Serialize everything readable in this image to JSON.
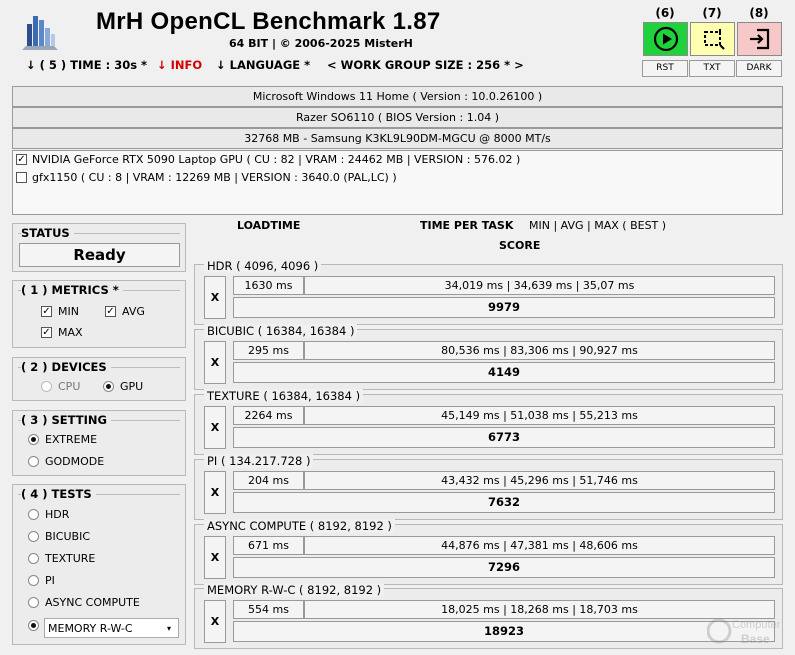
{
  "header": {
    "title": "MrH OpenCL Benchmark 1.87",
    "subtitle": "64 BIT | ©  2006-2025 MisterH",
    "logo_icon": "building-bars-logo"
  },
  "menu": {
    "time": "↓ ( 5 ) TIME : 30s *",
    "info": "↓ INFO",
    "language": "↓ LANGUAGE *",
    "work_group": "< WORK GROUP SIZE : 256 * >"
  },
  "toolbar": {
    "run": {
      "num": "(6)",
      "label": "RST",
      "icon": "play-circle-icon",
      "bg": "#1fd13a"
    },
    "txt": {
      "num": "(7)",
      "label": "TXT",
      "icon": "crop-select-icon",
      "bg": "#ffffb0"
    },
    "dark": {
      "num": "(8)",
      "label": "DARK",
      "icon": "exit-door-icon",
      "bg": "#f7c8c8"
    }
  },
  "system": {
    "os": "Microsoft Windows 11 Home ( Version : 10.0.26100 )",
    "board": "Razer SO6110 ( BIOS Version : 1.04 )",
    "memory": "32768 MB - Samsung K3KL9L90DM-MGCU     @ 8000 MT/s"
  },
  "gpus": [
    {
      "label": "NVIDIA GeForce RTX 5090 Laptop GPU ( CU : 82 | VRAM : 24462 MB | VERSION : 576.02 )",
      "checked": true
    },
    {
      "label": "gfx1150 ( CU : 8 | VRAM : 12269 MB | VERSION : 3640.0 (PAL,LC) )",
      "checked": false
    }
  ],
  "status": {
    "title": "STATUS",
    "value": "Ready"
  },
  "metrics": {
    "title": "( 1 ) METRICS *",
    "min": "MIN",
    "avg": "AVG",
    "max": "MAX"
  },
  "devices": {
    "title": "( 2 ) DEVICES",
    "cpu": "CPU",
    "gpu": "GPU"
  },
  "setting": {
    "title": "( 3 ) SETTING",
    "extreme": "EXTREME",
    "godmode": "GODMODE"
  },
  "tests": {
    "title": "( 4 ) TESTS",
    "items": [
      "HDR",
      "BICUBIC",
      "TEXTURE",
      "PI",
      "ASYNC COMPUTE"
    ],
    "selected": "MEMORY R-W-C"
  },
  "columns": {
    "loadtime": "LOADTIME",
    "time_per_task": "TIME PER TASK",
    "legend": "MIN | AVG | MAX ( BEST )",
    "score": "SCORE"
  },
  "results": [
    {
      "name": "HDR ( 4096, 4096 )",
      "x": "X",
      "load": "1630 ms",
      "times": "34,019 ms | 34,639 ms | 35,07 ms",
      "score": "9979"
    },
    {
      "name": "BICUBIC ( 16384, 16384 )",
      "x": "X",
      "load": "295 ms",
      "times": "80,536 ms | 83,306 ms | 90,927 ms",
      "score": "4149"
    },
    {
      "name": "TEXTURE ( 16384, 16384 )",
      "x": "X",
      "load": "2264 ms",
      "times": "45,149 ms | 51,038 ms | 55,213 ms",
      "score": "6773"
    },
    {
      "name": "PI ( 134.217.728 )",
      "x": "X",
      "load": "204 ms",
      "times": "43,432 ms | 45,296 ms | 51,746 ms",
      "score": "7632"
    },
    {
      "name": "ASYNC COMPUTE ( 8192, 8192 )",
      "x": "X",
      "load": "671 ms",
      "times": "44,876 ms | 47,381 ms | 48,606 ms",
      "score": "7296"
    },
    {
      "name": "MEMORY R-W-C ( 8192, 8192 )",
      "x": "X",
      "load": "554 ms",
      "times": "18,025 ms | 18,268 ms | 18,703 ms",
      "score": "18923"
    }
  ],
  "watermark": {
    "line1": "Computer",
    "line2": "Base"
  }
}
